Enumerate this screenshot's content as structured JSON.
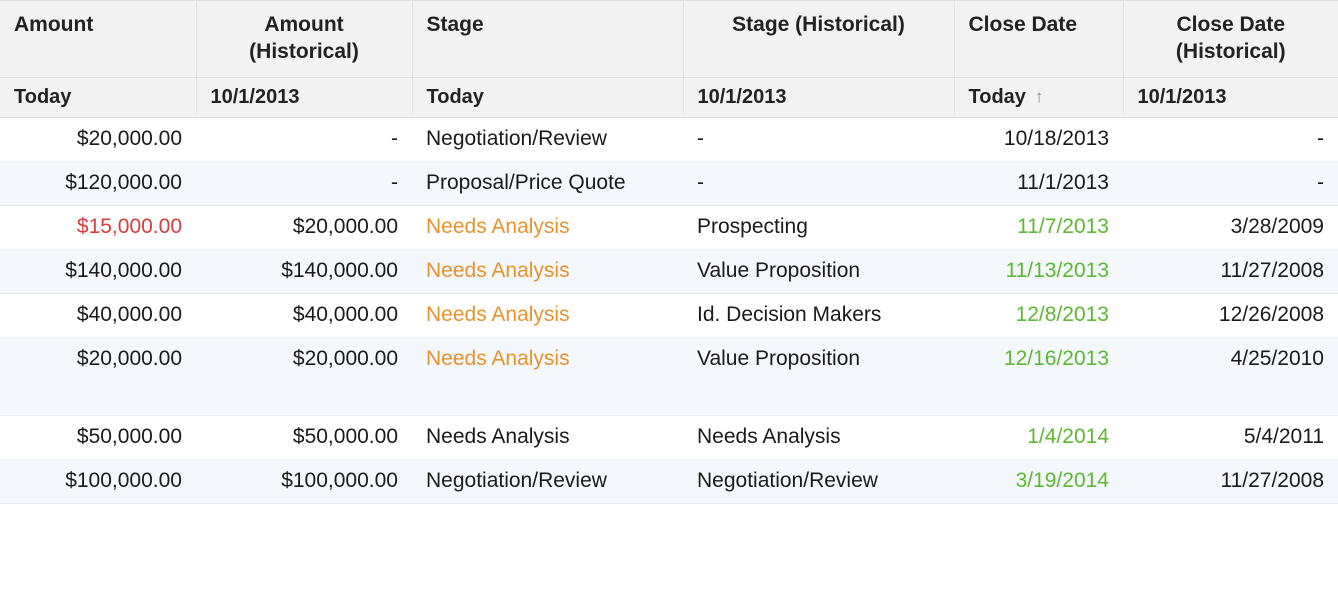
{
  "table": {
    "columns": [
      {
        "id": "amount",
        "label": "Amount",
        "align": "left",
        "subheader": "Today",
        "sorted": false
      },
      {
        "id": "amount_historical",
        "label": "Amount\n(Historical)",
        "align": "center",
        "subheader": "10/1/2013",
        "sorted": false
      },
      {
        "id": "stage",
        "label": "Stage",
        "align": "left",
        "subheader": "Today",
        "sorted": false
      },
      {
        "id": "stage_historical",
        "label": "Stage (Historical)",
        "align": "center",
        "subheader": "10/1/2013",
        "sorted": false
      },
      {
        "id": "close_date",
        "label": "Close Date",
        "align": "left",
        "subheader": "Today",
        "sorted": true
      },
      {
        "id": "close_date_hist",
        "label": "Close Date\n(Historical)",
        "align": "center",
        "subheader": "10/1/2013",
        "sorted": false
      }
    ],
    "header_labels": {
      "amount": "Amount",
      "amount_historical_line1": "Amount",
      "amount_historical_line2": "(Historical)",
      "stage": "Stage",
      "stage_historical": "Stage (Historical)",
      "close_date": "Close Date",
      "close_date_hist_line1": "Close Date",
      "close_date_hist_line2": "(Historical)"
    },
    "subheader_labels": {
      "amount": "Today",
      "amount_historical": "10/1/2013",
      "stage": "Today",
      "stage_historical": "10/1/2013",
      "close_date": "Today",
      "close_date_hist": "10/1/2013"
    },
    "sort_indicator_icon": "sort-ascending-arrow-icon",
    "sort_indicator_glyph": "↑",
    "empty_value": "-",
    "rows": [
      {
        "amount": "$20,000.00",
        "amount_color": "dark",
        "amount_historical": "-",
        "amount_historical_color": "dark",
        "stage": "Negotiation/Review",
        "stage_color": "dark",
        "stage_historical": "-",
        "stage_historical_color": "dark",
        "close_date": "10/18/2013",
        "close_date_color": "dark",
        "close_date_hist": "-",
        "close_date_hist_color": "dark",
        "banding": "odd",
        "tall": false
      },
      {
        "amount": "$120,000.00",
        "amount_color": "dark",
        "amount_historical": "-",
        "amount_historical_color": "dark",
        "stage": "Proposal/Price Quote",
        "stage_color": "dark",
        "stage_historical": "-",
        "stage_historical_color": "dark",
        "close_date": "11/1/2013",
        "close_date_color": "dark",
        "close_date_hist": "-",
        "close_date_hist_color": "dark",
        "banding": "even",
        "tall": false
      },
      {
        "amount": "$15,000.00",
        "amount_color": "red",
        "amount_historical": "$20,000.00",
        "amount_historical_color": "dark",
        "stage": "Needs Analysis",
        "stage_color": "orange",
        "stage_historical": "Prospecting",
        "stage_historical_color": "dark",
        "close_date": "11/7/2013",
        "close_date_color": "green",
        "close_date_hist": "3/28/2009",
        "close_date_hist_color": "dark",
        "banding": "odd",
        "tall": false
      },
      {
        "amount": "$140,000.00",
        "amount_color": "dark",
        "amount_historical": "$140,000.00",
        "amount_historical_color": "dark",
        "stage": "Needs Analysis",
        "stage_color": "orange",
        "stage_historical": "Value Proposition",
        "stage_historical_color": "dark",
        "close_date": "11/13/2013",
        "close_date_color": "green",
        "close_date_hist": "11/27/2008",
        "close_date_hist_color": "dark",
        "banding": "even",
        "tall": false
      },
      {
        "amount": "$40,000.00",
        "amount_color": "dark",
        "amount_historical": "$40,000.00",
        "amount_historical_color": "dark",
        "stage": "Needs Analysis",
        "stage_color": "orange",
        "stage_historical": "Id. Decision Makers",
        "stage_historical_color": "dark",
        "close_date": "12/8/2013",
        "close_date_color": "green",
        "close_date_hist": "12/26/2008",
        "close_date_hist_color": "dark",
        "banding": "odd",
        "tall": false
      },
      {
        "amount": "$20,000.00",
        "amount_color": "dark",
        "amount_historical": "$20,000.00",
        "amount_historical_color": "dark",
        "stage": "Needs Analysis",
        "stage_color": "orange",
        "stage_historical": "Value Proposition",
        "stage_historical_color": "dark",
        "close_date": "12/16/2013",
        "close_date_color": "green",
        "close_date_hist": "4/25/2010",
        "close_date_hist_color": "dark",
        "banding": "even",
        "tall": true
      },
      {
        "amount": "$50,000.00",
        "amount_color": "dark",
        "amount_historical": "$50,000.00",
        "amount_historical_color": "dark",
        "stage": "Needs Analysis",
        "stage_color": "dark",
        "stage_historical": "Needs Analysis",
        "stage_historical_color": "dark",
        "close_date": "1/4/2014",
        "close_date_color": "green",
        "close_date_hist": "5/4/2011",
        "close_date_hist_color": "dark",
        "banding": "odd",
        "tall": false
      },
      {
        "amount": "$100,000.00",
        "amount_color": "dark",
        "amount_historical": "$100,000.00",
        "amount_historical_color": "dark",
        "stage": "Negotiation/Review",
        "stage_color": "dark",
        "stage_historical": "Negotiation/Review",
        "stage_historical_color": "dark",
        "close_date": "3/19/2014",
        "close_date_color": "green",
        "close_date_hist": "11/27/2008",
        "close_date_hist_color": "dark",
        "banding": "even",
        "tall": false
      }
    ]
  },
  "colors": {
    "header_background": "#f2f2f2",
    "row_alt_background": "#f4f7fc",
    "row_background": "#ffffff",
    "text": "#1a1a1a",
    "orange": "#e8922a",
    "green": "#5cb82e",
    "red": "#d93b3b",
    "grid_line": "#dededb"
  }
}
